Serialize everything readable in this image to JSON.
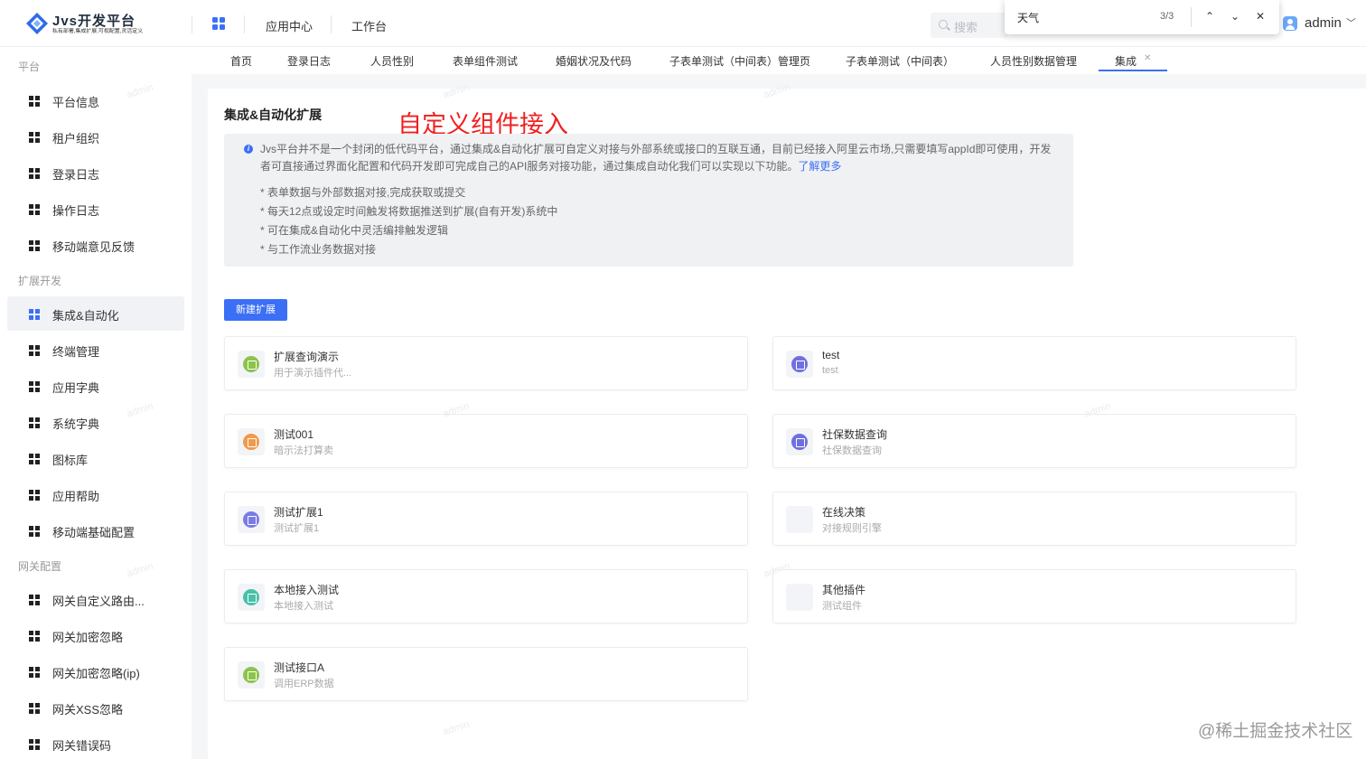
{
  "header": {
    "logo_title": "Jvs开发平台",
    "logo_subtitle": "私有部署,集成扩展,可视配置,灵活定义",
    "nav": [
      "应用中心",
      "工作台"
    ],
    "search_placeholder": "搜索",
    "user": "admin"
  },
  "find_bar": {
    "query": "天气",
    "count": "3/3",
    "prev": "⌃",
    "next": "⌄",
    "close": "✕"
  },
  "tabs": [
    "首页",
    "登录日志",
    "人员性别",
    "表单组件测试",
    "婚姻状况及代码",
    "子表单测试（中间表）管理页",
    "子表单测试（中间表）",
    "人员性别数据管理",
    "集成"
  ],
  "active_tab": "集成",
  "sidebar": {
    "groups": [
      {
        "title": "平台",
        "items": [
          "平台信息",
          "租户组织",
          "登录日志",
          "操作日志",
          "移动端意见反馈"
        ]
      },
      {
        "title": "扩展开发",
        "items": [
          "集成&自动化",
          "终端管理",
          "应用字典",
          "系统字典",
          "图标库",
          "应用帮助",
          "移动端基础配置"
        ]
      },
      {
        "title": "网关配置",
        "items": [
          "网关自定义路由...",
          "网关加密忽略",
          "网关加密忽略(ip)",
          "网关XSS忽略",
          "网关错误码"
        ]
      }
    ],
    "active_item": "集成&自动化"
  },
  "main": {
    "title": "集成&自动化扩展",
    "annotation": "自定义组件接入",
    "info_text": "Jvs平台并不是一个封闭的低代码平台，通过集成&自动化扩展可自定义对接与外部系统或接口的互联互通，目前已经接入阿里云市场,只需要填写appId即可使用，开发者可直接通过界面化配置和代码开发即可完成自己的API服务对接功能，通过集成自动化我们可以实现以下功能。",
    "info_link": "了解更多",
    "bullets": [
      "* 表单数据与外部数据对接,完成获取或提交",
      "* 每天12点或设定时间触发将数据推送到扩展(自有开发)系统中",
      "* 可在集成&自动化中灵活编排触发逻辑",
      "* 与工作流业务数据对接"
    ],
    "new_button": "新建扩展",
    "cards": [
      {
        "name": "扩展查询演示",
        "desc": "用于演示插件代...",
        "color": "#8cc34b"
      },
      {
        "name": "test",
        "desc": "test",
        "color": "#6f6fe0"
      },
      {
        "name": "测试001",
        "desc": "暗示法打算卖",
        "color": "#f09a4a"
      },
      {
        "name": "社保数据查询",
        "desc": "社保数据查询",
        "color": "#6f6fe0"
      },
      {
        "name": "测试扩展1",
        "desc": "测试扩展1",
        "color": "#7b7be6"
      },
      {
        "name": "在线决策",
        "desc": "对接规则引擎",
        "color": ""
      },
      {
        "name": "本地接入测试",
        "desc": "本地接入测试",
        "color": "#49c0a8"
      },
      {
        "name": "其他插件",
        "desc": "测试组件",
        "color": ""
      },
      {
        "name": "测试接口A",
        "desc": "调用ERP数据",
        "color": "#8cc34b"
      }
    ]
  },
  "watermark_text": "admin",
  "brand_watermark": "@稀土掘金技术社区"
}
